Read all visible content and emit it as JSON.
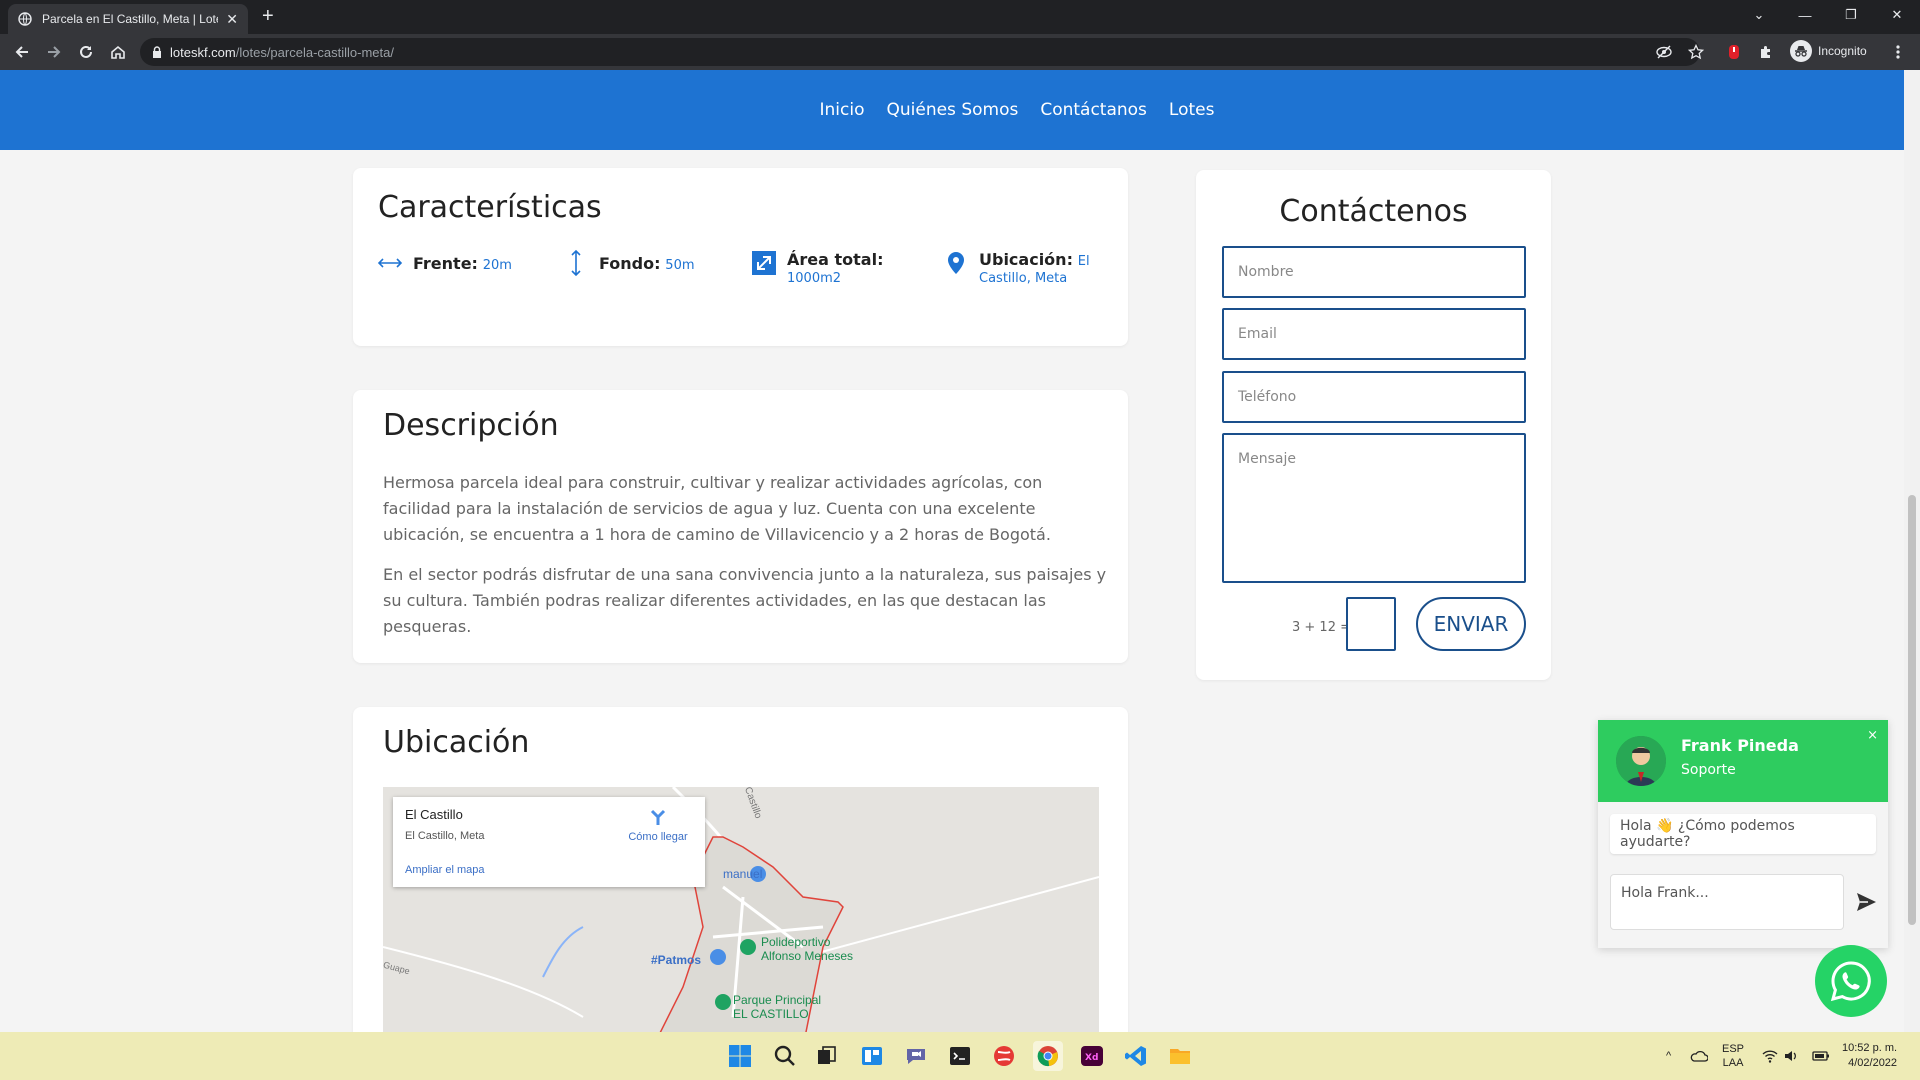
{
  "browser": {
    "tab_title": "Parcela en El Castillo, Meta | Lote",
    "url_domain": "loteskf.com",
    "url_path": "/lotes/parcela-castillo-meta/",
    "incognito_label": "Incognito"
  },
  "nav": {
    "items": [
      "Inicio",
      "Quiénes Somos",
      "Contáctanos",
      "Lotes"
    ]
  },
  "features": {
    "title": "Características",
    "items": [
      {
        "label": "Frente:",
        "value": "20m",
        "icon": "arrows-horizontal-icon"
      },
      {
        "label": "Fondo:",
        "value": "50m",
        "icon": "arrows-vertical-icon"
      },
      {
        "label": "Área total:",
        "value": "1000m2",
        "icon": "expand-icon"
      },
      {
        "label": "Ubicación:",
        "value_line1": "El",
        "value_line2": "Castillo, Meta",
        "icon": "map-pin-icon"
      }
    ]
  },
  "description": {
    "title": "Descripción",
    "p1": "Hermosa parcela ideal para construir, cultivar y realizar actividades agrícolas, con facilidad para la instalación de servicios de agua y luz. Cuenta con una excelente ubicación, se encuentra a 1 hora de camino de Villavicencio y a 2 horas de Bogotá.",
    "p2": "En el sector podrás disfrutar de una sana convivencia junto a la naturaleza, sus paisajes y su cultura. También podras realizar diferentes actividades, en las que destacan las pesqueras."
  },
  "location": {
    "title": "Ubicación",
    "map_place": "El Castillo",
    "map_address": "El Castillo, Meta",
    "map_directions": "Cómo llegar",
    "map_enlarge": "Ampliar el mapa",
    "map_labels": [
      "manuel",
      "Polideportivo",
      "Alfonso Meneses",
      "#Patmos",
      "Parque Principal",
      "EL CASTILLO",
      "l Castillo",
      "Guape"
    ]
  },
  "contact": {
    "title": "Contáctenos",
    "name_placeholder": "Nombre",
    "email_placeholder": "Email",
    "phone_placeholder": "Teléfono",
    "message_placeholder": "Mensaje",
    "captcha": "3 + 12 =",
    "send_label": "ENVIAR"
  },
  "chat": {
    "name": "Frank Pineda",
    "role": "Soporte",
    "greeting": "Hola 👋 ¿Cómo podemos ayudarte?",
    "input_value": "Hola Frank...",
    "close": "×",
    "header_color": "#2ecc5f"
  },
  "taskbar": {
    "lang_line1": "ESP",
    "lang_line2": "LAA",
    "time": "10:52 p. m.",
    "date": "4/02/2022"
  },
  "colors": {
    "brand_blue": "#1e73d2",
    "field_border": "#1a4f8b",
    "whatsapp_green": "#25d366"
  }
}
